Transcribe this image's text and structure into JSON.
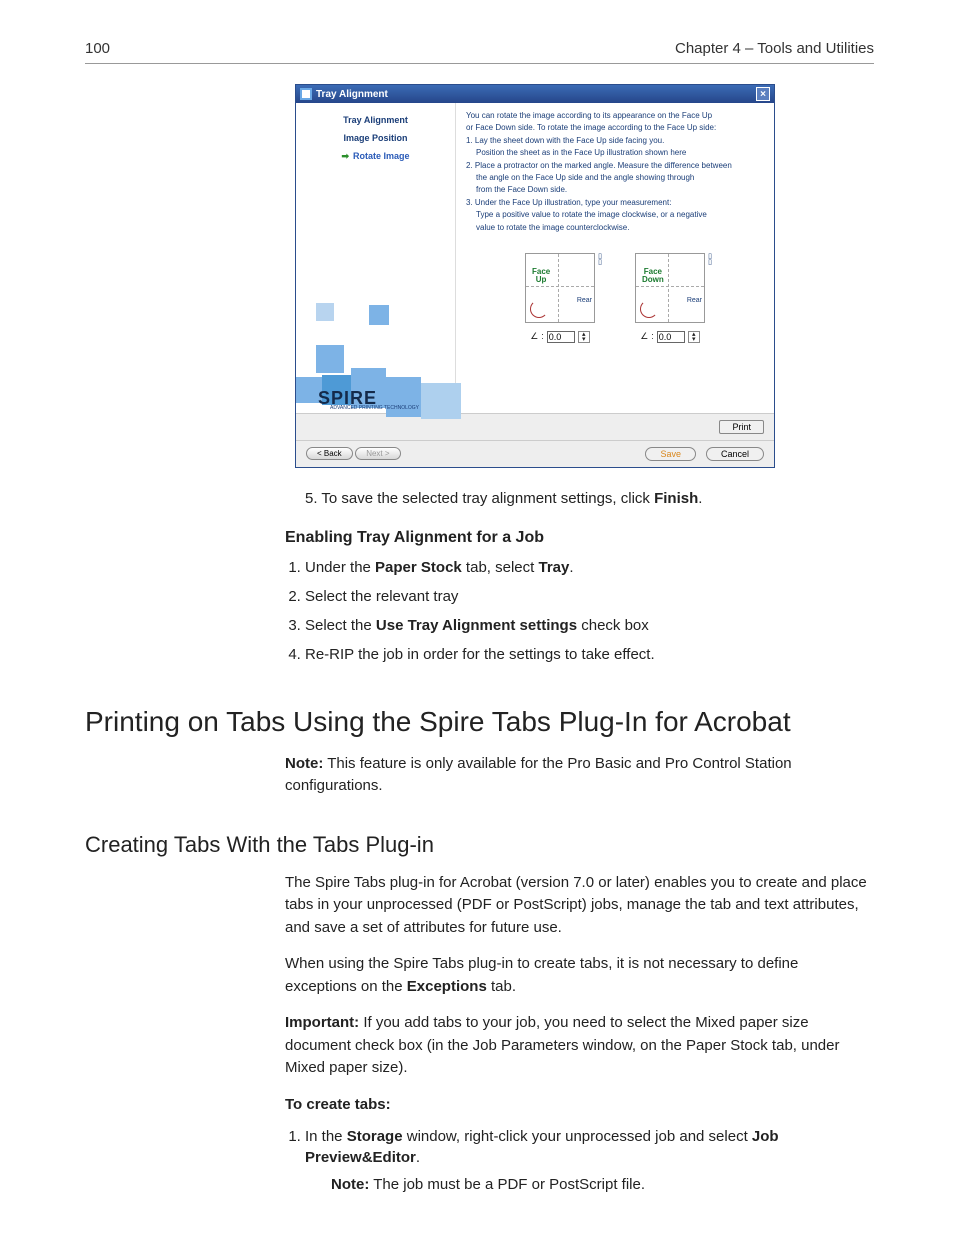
{
  "header": {
    "page_number": "100",
    "chapter": "Chapter 4 – Tools and Utilities"
  },
  "dialog": {
    "title": "Tray Alignment",
    "close": "×",
    "nav": {
      "item1": "Tray Alignment",
      "item2": "Image Position",
      "item3": "Rotate Image"
    },
    "logo": "SPIRE",
    "logo_tag": "ADVANCED PRINTING TECHNOLOGY",
    "instructions": {
      "l0": "You can rotate the image according to its appearance on the Face Up",
      "l1": "or Face Down side. To rotate the image according to the Face Up side:",
      "l2": "1. Lay the sheet down with the Face Up side facing you.",
      "l3": "Position the sheet as in the Face Up illustration shown here",
      "l4": "2. Place a protractor on the marked angle. Measure the difference between",
      "l5": "the angle on the Face Up side and the angle showing through",
      "l6": "from the Face Down side.",
      "l7": "3. Under the Face Up illustration, type your measurement:",
      "l8": "Type a positive value to rotate the image clockwise, or a negative",
      "l9": "value to rotate the image counterclockwise."
    },
    "preview": {
      "face_up": "Face\nUp",
      "face_down": "Face\nDown",
      "rear": "Rear",
      "angle_sym": "∠",
      "colon": ":",
      "value": "0.0"
    },
    "buttons": {
      "print": "Print",
      "back": "< Back",
      "next": "Next >",
      "save": "Save",
      "cancel": "Cancel"
    }
  },
  "step5": {
    "text_before": "To save the selected tray alignment settings, click ",
    "bold": "Finish",
    "after": "."
  },
  "enabling": {
    "heading": "Enabling Tray Alignment for a Job",
    "s1a": "Under the ",
    "s1b": "Paper Stock",
    "s1c": " tab, select ",
    "s1d": "Tray",
    "s1e": ".",
    "s2": "Select the relevant tray",
    "s3a": "Select the ",
    "s3b": "Use Tray Alignment settings",
    "s3c": " check box",
    "s4": "Re-RIP the job in order for the settings to take effect."
  },
  "main_heading": "Printing on Tabs Using the Spire Tabs Plug-In for Acrobat",
  "note1": {
    "label": "Note:",
    "text": "  This feature is only available for the Pro Basic and Pro Control Station configurations."
  },
  "section_heading": "Creating Tabs With the Tabs Plug-in",
  "para1": "The Spire Tabs plug-in for Acrobat (version 7.0 or later) enables you to create and place tabs in your unprocessed (PDF or PostScript) jobs, manage the tab and text attributes, and save a set of attributes for future use.",
  "para2": {
    "a": "When using the Spire Tabs plug-in to create tabs, it is not necessary to define exceptions on the ",
    "b": "Exceptions",
    "c": " tab."
  },
  "important": {
    "label": "Important:",
    "text": "  If you add tabs to your job, you need to select the Mixed paper size document check box (in the Job Parameters window, on the Paper Stock tab, under Mixed paper size)."
  },
  "create_tabs_heading": "To create tabs:",
  "step_create": {
    "a": "In the ",
    "b": "Storage",
    "c": " window, right-click your unprocessed job and select ",
    "d": "Job Preview&Editor",
    "e": "."
  },
  "note2": {
    "label": "Note:",
    "text": "  The job must be a PDF or PostScript file."
  }
}
